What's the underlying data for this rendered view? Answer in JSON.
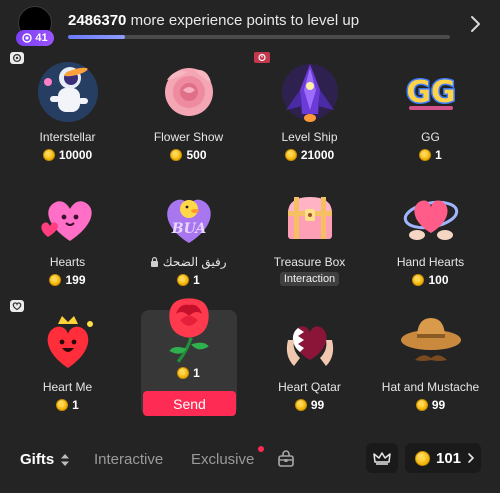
{
  "header": {
    "level": "41",
    "xp_amount": "2486370",
    "xp_text": "more experience points to level up",
    "xp_progress": 0.15
  },
  "gifts": [
    {
      "name": "Interstellar",
      "price": "10000",
      "icon": "astronaut-icon"
    },
    {
      "name": "Flower Show",
      "price": "500",
      "icon": "pink-rose-icon"
    },
    {
      "name": "Level Ship",
      "price": "21000",
      "icon": "spaceship-icon"
    },
    {
      "name": "GG",
      "price": "1",
      "icon": "gg-text-icon"
    },
    {
      "name": "Hearts",
      "price": "199",
      "icon": "pink-hearts-icon"
    },
    {
      "name": "رفيق الضحك",
      "price": "1",
      "icon": "duck-bua-icon"
    },
    {
      "name": "Treasure Box",
      "tag": "Interaction",
      "icon": "treasure-chest-icon"
    },
    {
      "name": "Hand Hearts",
      "price": "100",
      "icon": "hand-hearts-icon"
    },
    {
      "name": "Heart Me",
      "price": "1",
      "icon": "crowned-heart-icon"
    },
    {
      "name": "",
      "price": "1",
      "icon": "red-rose-icon",
      "selected": true
    },
    {
      "name": "Heart Qatar",
      "price": "99",
      "icon": "qatar-heart-hands-icon"
    },
    {
      "name": "Hat and Mustache",
      "price": "99",
      "icon": "cowboy-hat-mustache-icon"
    }
  ],
  "send_label": "Send",
  "tabs": {
    "gifts": "Gifts",
    "interactive": "Interactive",
    "exclusive": "Exclusive"
  },
  "balance": "101",
  "colors": {
    "accent": "#fe2c55",
    "background": "#242424",
    "level_badge": "#8a4bf5",
    "xp_fill": "#7a88ff",
    "coin": "#f2b300"
  }
}
